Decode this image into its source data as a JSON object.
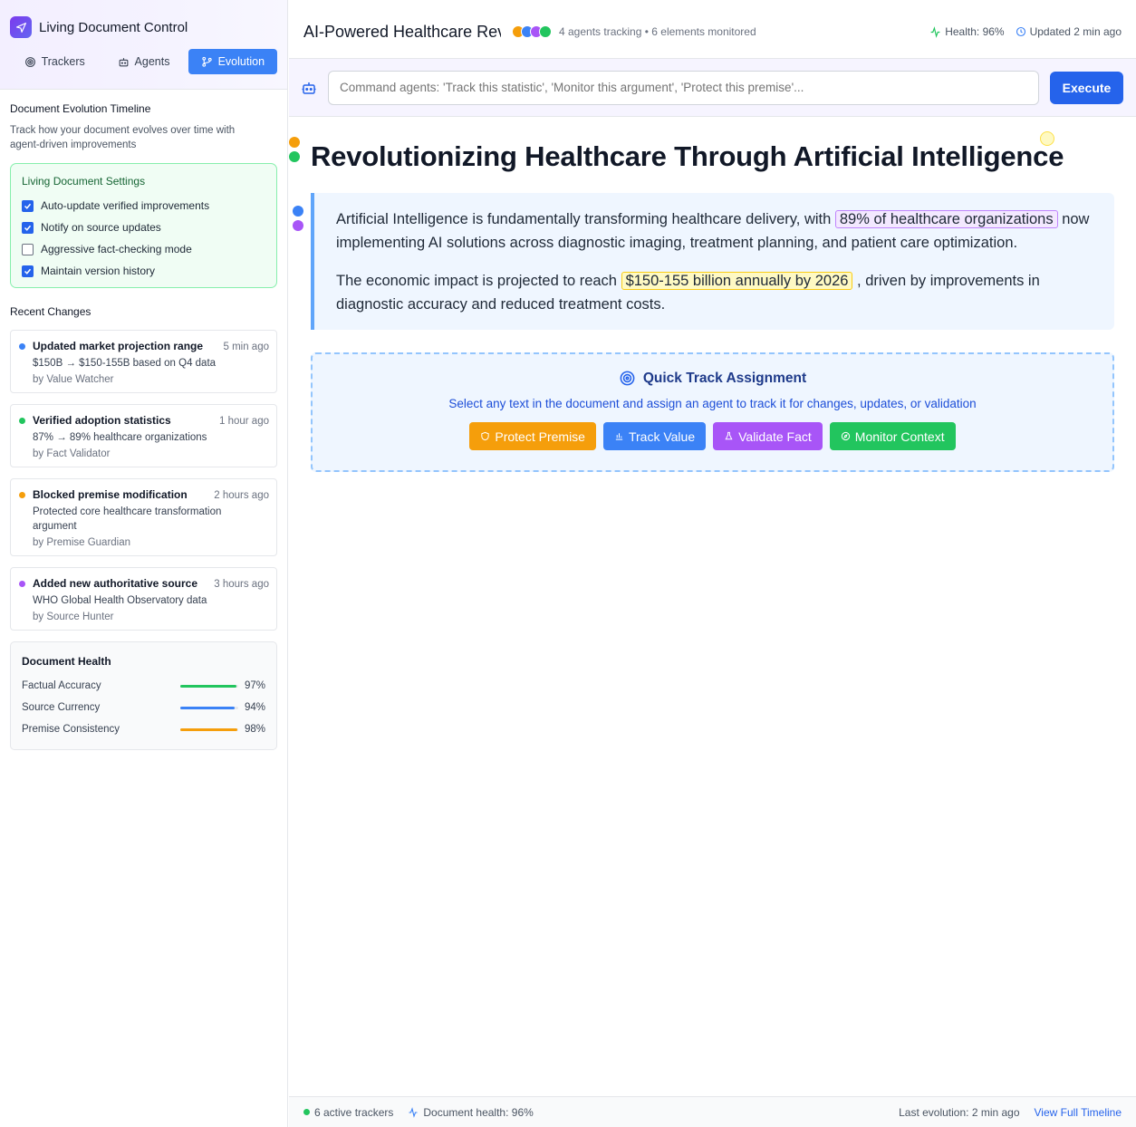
{
  "sidebar": {
    "title": "Living Document Control",
    "tabs": [
      {
        "label": "Trackers",
        "icon": "target-icon",
        "active": false
      },
      {
        "label": "Agents",
        "icon": "bot-icon",
        "active": false
      },
      {
        "label": "Evolution",
        "icon": "git-branch-icon",
        "active": true
      }
    ],
    "timeline_title": "Document Evolution Timeline",
    "timeline_desc": "Track how your document evolves over time with agent-driven improvements",
    "settings": {
      "title": "Living Document Settings",
      "options": [
        {
          "label": "Auto-update verified improvements",
          "checked": true
        },
        {
          "label": "Notify on source updates",
          "checked": true
        },
        {
          "label": "Aggressive fact-checking mode",
          "checked": false
        },
        {
          "label": "Maintain version history",
          "checked": true
        }
      ]
    },
    "recent_title": "Recent Changes",
    "changes": [
      {
        "title": "Updated market projection range",
        "time": "5 min ago",
        "detail": "$150B → $150-155B based on Q4 data",
        "by": "by Value Watcher",
        "color": "#3b82f6"
      },
      {
        "title": "Verified adoption statistics",
        "time": "1 hour ago",
        "detail": "87% → 89% healthcare organizations",
        "by": "by Fact Validator",
        "color": "#22c55e"
      },
      {
        "title": "Blocked premise modification",
        "time": "2 hours ago",
        "detail": "Protected core healthcare transformation argument",
        "by": "by Premise Guardian",
        "color": "#f59e0b"
      },
      {
        "title": "Added new authoritative source",
        "time": "3 hours ago",
        "detail": "WHO Global Health Observatory data",
        "by": "by Source Hunter",
        "color": "#a855f7"
      }
    ],
    "health": {
      "title": "Document Health",
      "metrics": [
        {
          "label": "Factual Accuracy",
          "value": "97%",
          "fraction": 0.97,
          "color": "#22c55e"
        },
        {
          "label": "Source Currency",
          "value": "94%",
          "fraction": 0.94,
          "color": "#3b82f6"
        },
        {
          "label": "Premise Consistency",
          "value": "98%",
          "fraction": 0.98,
          "color": "#f59e0b"
        }
      ]
    }
  },
  "header": {
    "doc_title": "AI-Powered Healthcare Rev",
    "agent_colors": [
      "#f59e0b",
      "#3b82f6",
      "#a855f7",
      "#22c55e"
    ],
    "tracking_info": "4 agents tracking • 6 elements monitored",
    "health": "Health: 96%",
    "updated": "Updated 2 min ago"
  },
  "command": {
    "placeholder": "Command agents: 'Track this statistic', 'Monitor this argument', 'Protect this premise'...",
    "execute_label": "Execute"
  },
  "document": {
    "heading": "Revolutionizing Healthcare Through Artificial Intelligence",
    "p1_before": "Artificial Intelligence is fundamentally transforming healthcare delivery, with ",
    "p1_highlight": "89% of healthcare organizations",
    "p1_after": " now implementing AI solutions across diagnostic imaging, treatment planning, and patient care optimization.",
    "p2_before": "The economic impact is projected to reach ",
    "p2_highlight": "$150-155 billion annually by 2026",
    "p2_after": " , driven by improvements in diagnostic accuracy and reduced treatment costs."
  },
  "quick_track": {
    "title": "Quick Track Assignment",
    "desc": "Select any text in the document and assign an agent to track it for changes, updates, or validation",
    "buttons": [
      {
        "label": "Protect Premise",
        "color": "#f59e0b",
        "icon": "shield-icon"
      },
      {
        "label": "Track Value",
        "color": "#3b82f6",
        "icon": "bar-chart-icon"
      },
      {
        "label": "Validate Fact",
        "color": "#a855f7",
        "icon": "flask-icon"
      },
      {
        "label": "Monitor Context",
        "color": "#22c55e",
        "icon": "compass-icon"
      }
    ]
  },
  "footer": {
    "trackers": "6 active trackers",
    "doc_health": "Document health: 96%",
    "last_evolution": "Last evolution: 2 min ago",
    "timeline_link": "View Full Timeline"
  }
}
